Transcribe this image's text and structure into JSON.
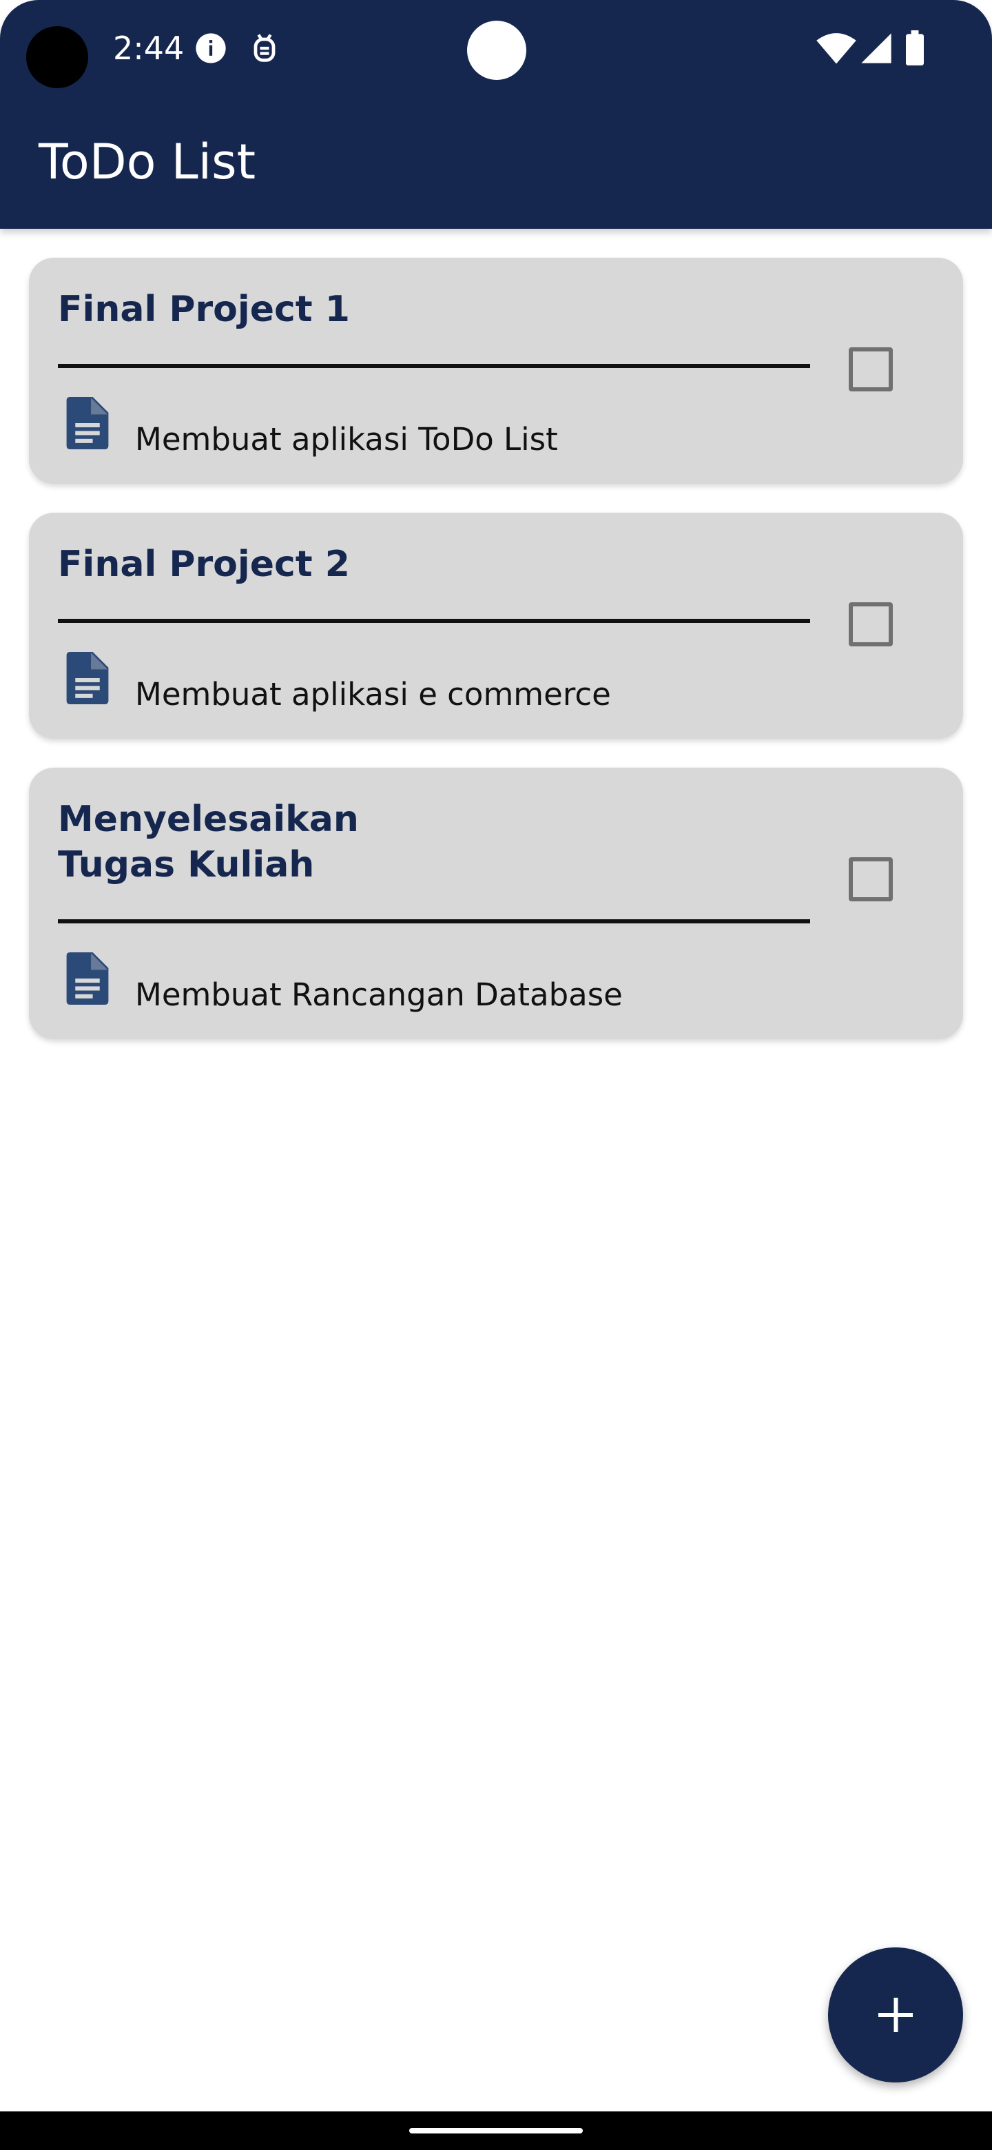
{
  "status_bar": {
    "time": "2:44",
    "icons": [
      "info-icon",
      "debug-icon",
      "wifi-icon",
      "signal-icon",
      "battery-icon"
    ]
  },
  "app_bar": {
    "title": "ToDo List"
  },
  "todos": [
    {
      "title": "Final Project 1",
      "description": "Membuat aplikasi ToDo List",
      "checked": false,
      "icon": "document-icon"
    },
    {
      "title": "Final Project 2",
      "description": "Membuat aplikasi e commerce",
      "checked": false,
      "icon": "document-icon"
    },
    {
      "title": "Menyelesaikan Tugas Kuliah",
      "description": "Membuat Rancangan Database",
      "checked": false,
      "icon": "document-icon"
    }
  ],
  "fab": {
    "icon": "plus-icon"
  },
  "colors": {
    "primary": "#16274f",
    "card_background": "#d8d8d8",
    "doc_icon": "#2c4a78",
    "checkbox_border": "#707070"
  }
}
